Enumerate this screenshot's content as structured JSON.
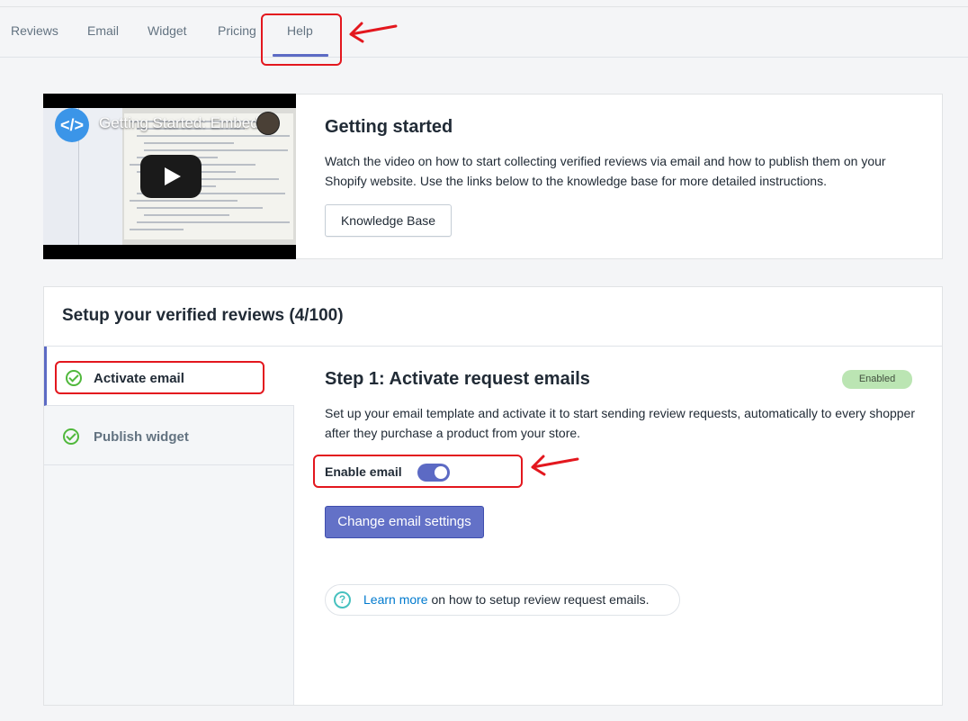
{
  "tabs": [
    {
      "label": "Reviews"
    },
    {
      "label": "Email"
    },
    {
      "label": "Widget"
    },
    {
      "label": "Pricing"
    },
    {
      "label": "Help"
    }
  ],
  "active_tab": "Help",
  "video": {
    "title": "Getting Started: Embed...",
    "logo": "</>"
  },
  "getting_started": {
    "title": "Getting started",
    "description": "Watch the video on how to start collecting verified reviews via email and how to publish them on your Shopify website. Use the links below to the knowledge base for more detailed instructions.",
    "button": "Knowledge Base"
  },
  "setup": {
    "title": "Setup your verified reviews (4/100)",
    "steps": [
      {
        "label": "Activate email",
        "icon": "check-circle-icon"
      },
      {
        "label": "Publish widget",
        "icon": "check-circle-icon"
      }
    ]
  },
  "step": {
    "title": "Step 1: Activate request emails",
    "badge": "Enabled",
    "description": "Set up your email template and activate it to start sending review requests, automatically to every shopper after they purchase a product from your store.",
    "toggle_label": "Enable email",
    "toggle_on": true,
    "button": "Change email settings",
    "info_link": "Learn more",
    "info_text": " on how to setup review request emails."
  },
  "colors": {
    "accent": "#5c6ac4",
    "highlight": "#e3171e",
    "success": "#50b83c",
    "badge": "#bbe5b3"
  }
}
